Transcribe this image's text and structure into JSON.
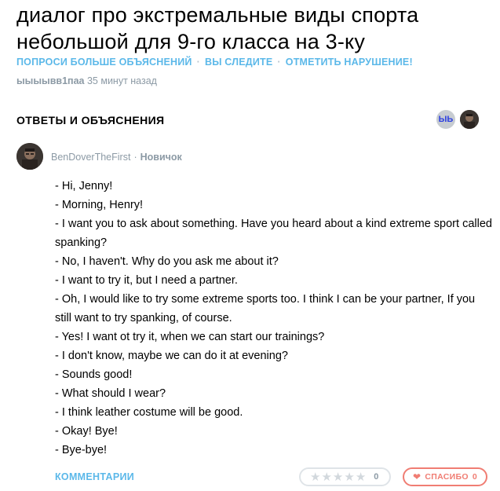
{
  "question": {
    "title": "диалог про экстремальные виды спорта небольшой для 9-го класса на 3-ку",
    "actions": [
      "ПОПРОСИ БОЛЬШЕ ОБЪЯСНЕНИЙ",
      "ВЫ СЛЕДИТЕ",
      "ОТМЕТИТЬ НАРУШЕНИЕ!"
    ],
    "separator": "·",
    "author": "ыыыывв1паа",
    "time_ago": "35 минут назад"
  },
  "answers_section": {
    "header": "ОТВЕТЫ И ОБЪЯСНЕНИЯ",
    "avatar_text": "ЫЬ"
  },
  "answer": {
    "author": "BenDoverTheFirst",
    "separator": "·",
    "rank": "Новичок",
    "lines": [
      "- Hi, Jenny!",
      "- Morning, Henry!",
      "- I want you to ask about something. Have you heard about a kind extreme sport called spanking?",
      "- No, I haven't. Why do you ask me about it?",
      "- I want to try it, but I need a partner.",
      "- Oh, I would like to try some extreme sports too. I think I can be your partner, If you still want to try spanking, of course.",
      "- Yes! I want ot try it, when we can start our trainings?",
      "- I don't know, maybe we can do it at evening?",
      "- Sounds good!",
      "- What should I wear?",
      "- I think leather costume will be good.",
      "- Okay! Bye!",
      "- Bye-bye!"
    ],
    "comments_label": "КОММЕНТАРИИ",
    "rating": {
      "stars_total": 5,
      "stars_filled": 0,
      "count": "0"
    },
    "thanks": {
      "label": "СПАСИБО",
      "count": "0"
    }
  }
}
